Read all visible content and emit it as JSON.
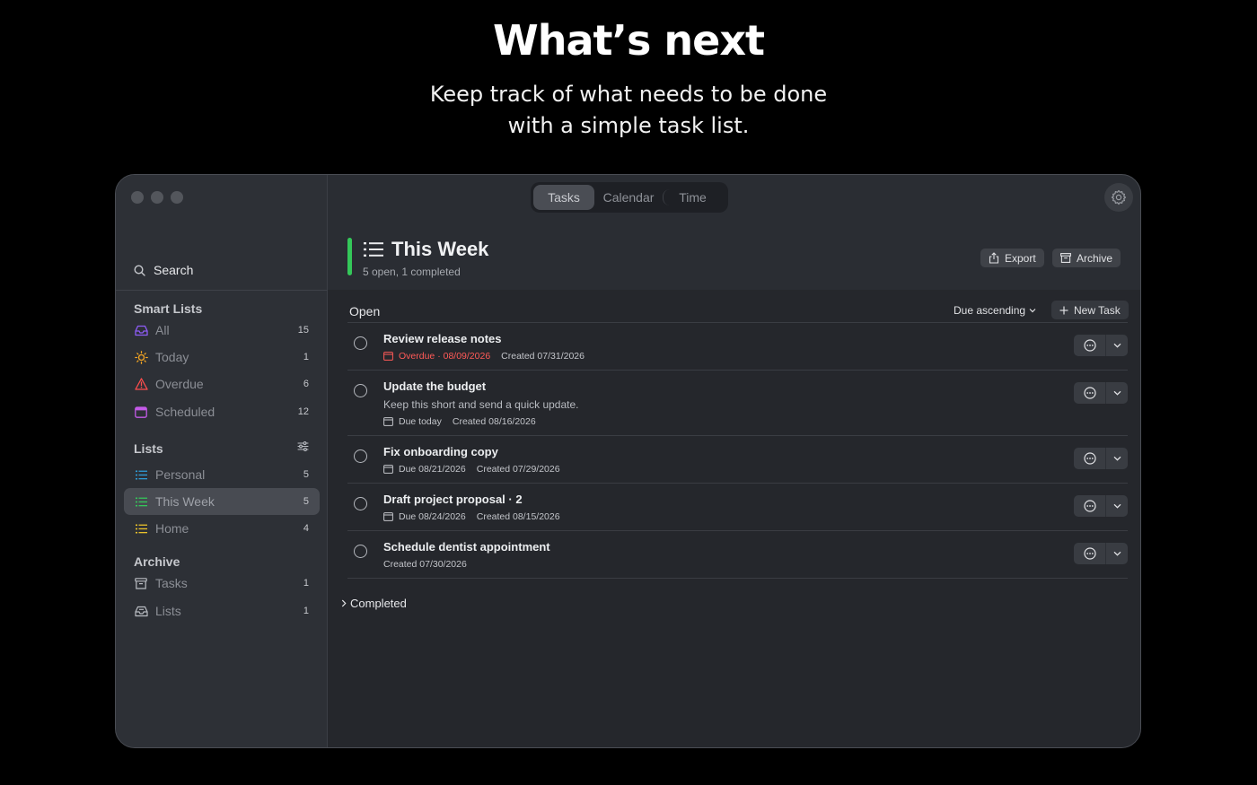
{
  "hero": {
    "title": "What’s next",
    "subtitle_line1": "Keep track of what needs to be done",
    "subtitle_line2": "with a simple task list."
  },
  "toolbar": {
    "tabs": [
      {
        "label": "Tasks",
        "active": true
      },
      {
        "label": "Calendar",
        "active": false
      },
      {
        "label": "Time",
        "active": false
      }
    ]
  },
  "sidebar": {
    "search_label": "Search",
    "smart_lists_title": "Smart Lists",
    "smart_lists": [
      {
        "label": "All",
        "count": "15",
        "icon": "tray-icon",
        "color": "#8e5cf7"
      },
      {
        "label": "Today",
        "count": "1",
        "icon": "sun-icon",
        "color": "#f5a623"
      },
      {
        "label": "Overdue",
        "count": "6",
        "icon": "warning-icon",
        "color": "#ff4d4d"
      },
      {
        "label": "Scheduled",
        "count": "12",
        "icon": "calendar-icon",
        "color": "#c45ae8"
      }
    ],
    "lists_title": "Lists",
    "lists": [
      {
        "label": "Personal",
        "count": "5",
        "icon": "list-icon",
        "color": "#2f9bd6"
      },
      {
        "label": "This Week",
        "count": "5",
        "icon": "list-icon",
        "color": "#34c759",
        "selected": true
      },
      {
        "label": "Home",
        "count": "4",
        "icon": "list-icon",
        "color": "#e8c12b"
      }
    ],
    "archive_title": "Archive",
    "archive": [
      {
        "label": "Tasks",
        "count": "1",
        "icon": "archive-box-icon"
      },
      {
        "label": "Lists",
        "count": "1",
        "icon": "archive-tray-icon"
      }
    ]
  },
  "header": {
    "title": "This Week",
    "subtitle": "5 open, 1 completed",
    "accent_color": "#34c759",
    "export_label": "Export",
    "archive_label": "Archive"
  },
  "main": {
    "section_open": "Open",
    "sort_label": "Due ascending",
    "new_task_label": "New Task",
    "completed_label": "Completed",
    "tasks": [
      {
        "title": "Review release notes",
        "due": "Overdue · 08/09/2026",
        "overdue": true,
        "created": "Created 07/31/2026"
      },
      {
        "title": "Update the budget",
        "note": "Keep this short and send a quick update.",
        "due": "Due today",
        "created": "Created 08/16/2026"
      },
      {
        "title": "Fix onboarding copy",
        "due": "Due 08/21/2026",
        "created": "Created 07/29/2026"
      },
      {
        "title": "Draft project proposal · 2",
        "due": "Due 08/24/2026",
        "created": "Created 08/15/2026"
      },
      {
        "title": "Schedule dentist appointment",
        "created": "Created 07/30/2026"
      }
    ]
  }
}
